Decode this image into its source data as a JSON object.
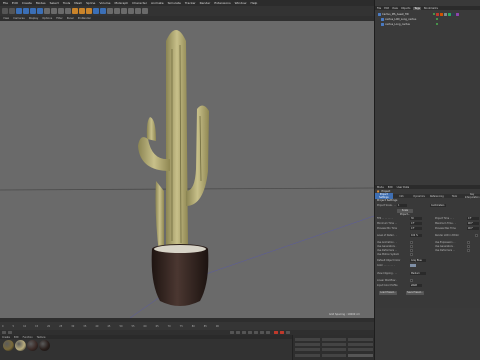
{
  "menubar": {
    "items": [
      "File",
      "Edit",
      "Create",
      "Modes",
      "Select",
      "Tools",
      "Mesh",
      "Spline",
      "Volume",
      "MoGraph",
      "Character",
      "Animate",
      "Simulate",
      "Tracker",
      "Render",
      "Extensions",
      "Window",
      "Help"
    ]
  },
  "viewport": {
    "menu": [
      "View",
      "Cameras",
      "Display",
      "Options",
      "Filter",
      "Panel",
      "ProRender"
    ],
    "info": "Grid Spacing : 10000 cm"
  },
  "timeline": {
    "ticks": [
      "0",
      "5",
      "10",
      "15",
      "20",
      "25",
      "30",
      "35",
      "40",
      "45",
      "50",
      "55",
      "60",
      "65",
      "70",
      "75",
      "80",
      "85",
      "90"
    ]
  },
  "materials": {
    "menu": [
      "Create",
      "Edit",
      "Function",
      "Texture"
    ],
    "swatches": [
      "#7a6a3a",
      "#b9ad7e",
      "#3b2a26",
      "#2a1f1c"
    ]
  },
  "coords": {
    "rows": [
      "Position",
      "Size",
      "Rotation"
    ],
    "apply": "Apply"
  },
  "objects": {
    "menu": [
      "File",
      "Edit",
      "View",
      "Objects",
      "Tags",
      "Bookmarks"
    ],
    "active_tab": "Tags",
    "rows": [
      {
        "name": "Cactus_MS_Asset_HD"
      },
      {
        "name": "cactus_LOD_Long_cactus"
      },
      {
        "name": "cactus_Long_cactus"
      }
    ],
    "tag_colors": [
      "#c0392b",
      "#d35400",
      "#7f8c8d",
      "#27ae60",
      "#2c3e50",
      "#8e44ad"
    ]
  },
  "attributes": {
    "menu": [
      "Mode",
      "Edit",
      "User Data"
    ],
    "header": "Project",
    "tabs": [
      "Project Settings",
      "Info",
      "Dynamics",
      "Referencing",
      "Todo",
      "Key Interpolation"
    ],
    "active_tab": "Project Settings",
    "section_title": "Project Settings",
    "scale_label": "Project Scale . . .",
    "scale_value": "1",
    "scale_unit": "Centimeters",
    "scale_button": "Scale Project...",
    "left_fields": [
      {
        "label": "FPS . . . . . . . .",
        "value": "30"
      },
      {
        "label": "Minimum Time . .",
        "value": "0 F"
      },
      {
        "label": "Preview Min Time",
        "value": "0 F"
      },
      {
        "label": "Level of Detail . .",
        "value": "100 %"
      }
    ],
    "right_fields": [
      {
        "label": "Project Time . . .",
        "value": "0 F"
      },
      {
        "label": "Maximum Time . .",
        "value": "90 F"
      },
      {
        "label": "Preview Max Time",
        "value": "90 F"
      },
      {
        "label": "Render LOD in Editor",
        "value": ""
      }
    ],
    "checks_left": [
      "Use Animation . .",
      "Use Generators .",
      "Use Deformers . .",
      "Use Motion System"
    ],
    "checks_right": [
      "Use Expression . .",
      "Use Generators .",
      "Use Deformers . ."
    ],
    "default_color_label": "Default Object Color",
    "default_color_value": "Gray Blue",
    "color_label": "Color . . . . . . . .",
    "view_clipping_label": "View Clipping . . .",
    "view_clipping_value": "Medium",
    "linear_label": "Linear Workflow .",
    "input_color_label": "Input Color Profile",
    "input_color_value": "sRGB",
    "load_button": "Load Preset...",
    "save_button": "Save Preset..."
  }
}
